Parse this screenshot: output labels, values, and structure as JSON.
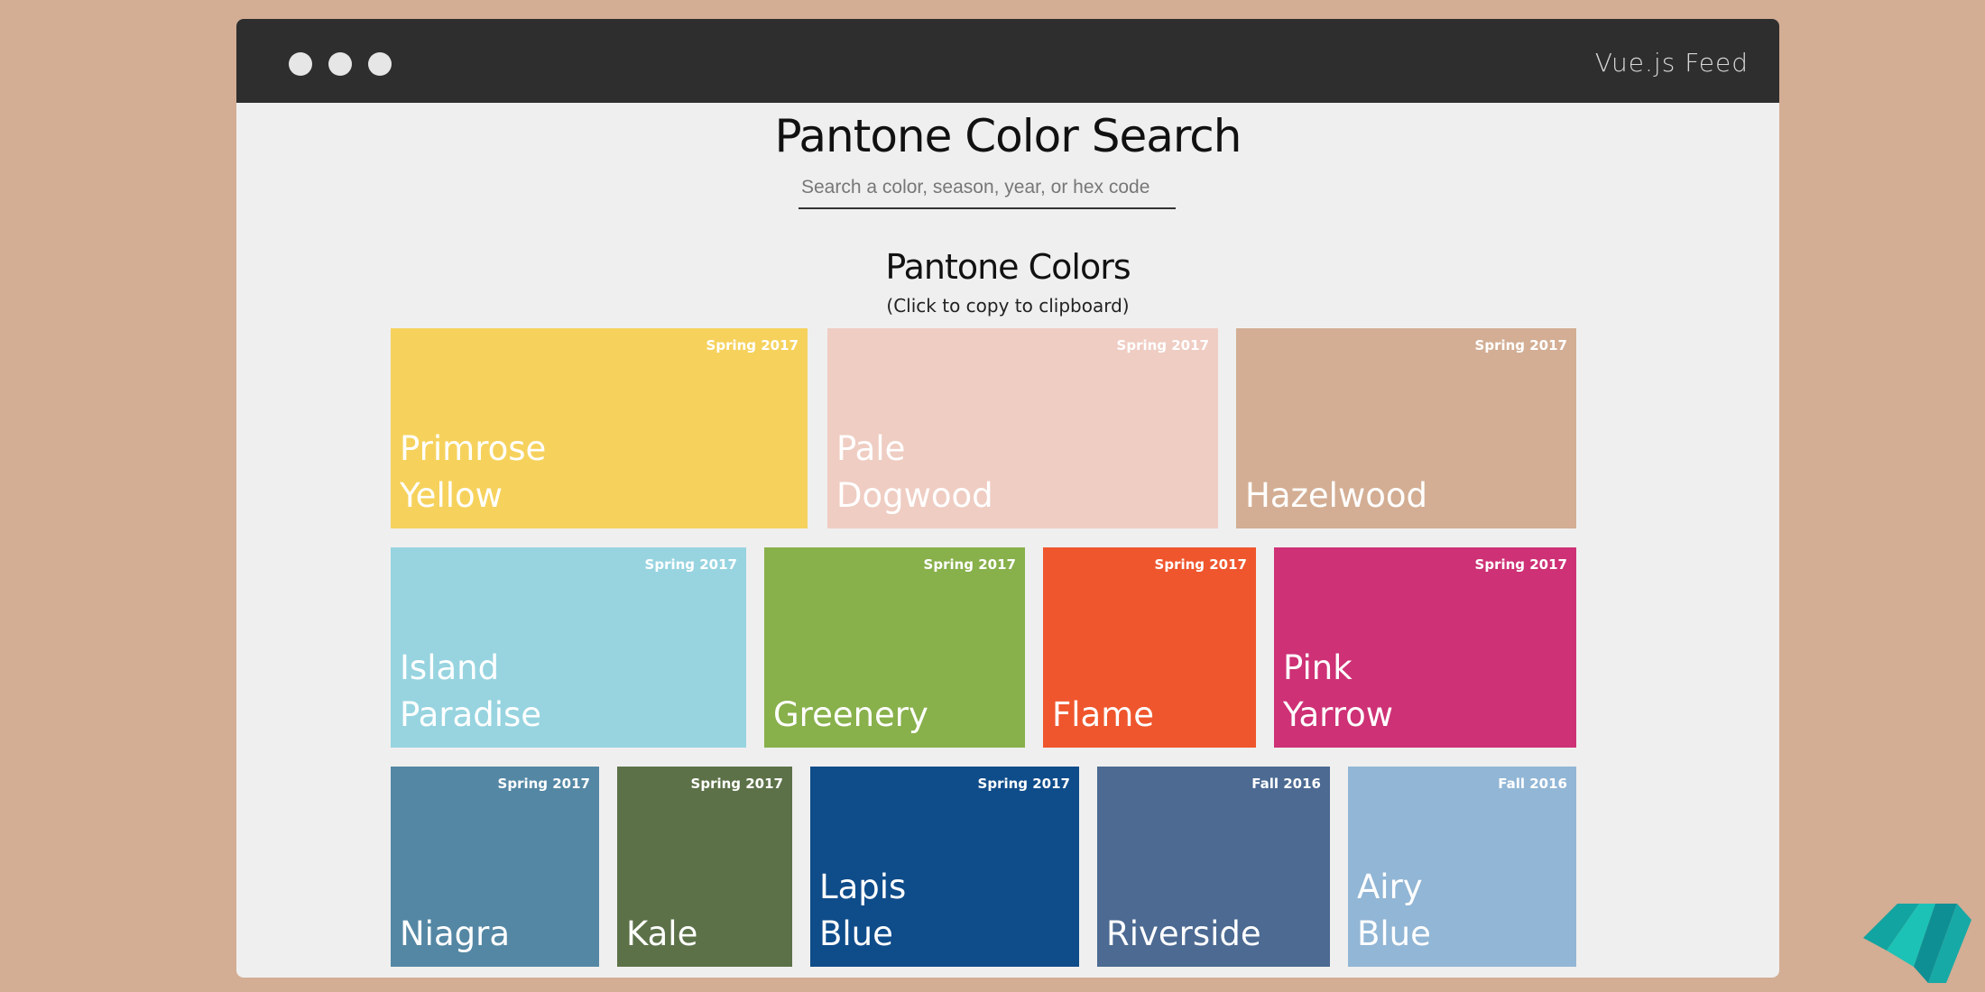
{
  "window": {
    "brand": "Vue.js Feed"
  },
  "page": {
    "title": "Pantone Color Search",
    "search_placeholder": "Search a color, season, year, or hex code",
    "section_title": "Pantone Colors",
    "section_subtitle": "(Click to copy to clipboard)"
  },
  "colors": [
    {
      "name": "Primrose Yellow",
      "season": "Spring 2017",
      "hex": "#f6d25d"
    },
    {
      "name": "Pale Dogwood",
      "season": "Spring 2017",
      "hex": "#efcdc3"
    },
    {
      "name": "Hazelwood",
      "season": "Spring 2017",
      "hex": "#d3ae94"
    },
    {
      "name": "Island Paradise",
      "season": "Spring 2017",
      "hex": "#97d4e0"
    },
    {
      "name": "Greenery",
      "season": "Spring 2017",
      "hex": "#88b04b"
    },
    {
      "name": "Flame",
      "season": "Spring 2017",
      "hex": "#ef562d"
    },
    {
      "name": "Pink Yarrow",
      "season": "Spring 2017",
      "hex": "#ce3175"
    },
    {
      "name": "Niagra",
      "season": "Spring 2017",
      "hex": "#5487a4"
    },
    {
      "name": "Kale",
      "season": "Spring 2017",
      "hex": "#5c7148"
    },
    {
      "name": "Lapis Blue",
      "season": "Spring 2017",
      "hex": "#0f4c8a"
    },
    {
      "name": "Riverside",
      "season": "Fall 2016",
      "hex": "#4c6a92"
    },
    {
      "name": "Airy Blue",
      "season": "Fall 2016",
      "hex": "#92b6d5"
    }
  ],
  "theme": {
    "background": "#d3ad94",
    "titlebar": "#2e2e2e",
    "content_bg": "#efefef",
    "logo_icon": "vue-logo-icon"
  }
}
